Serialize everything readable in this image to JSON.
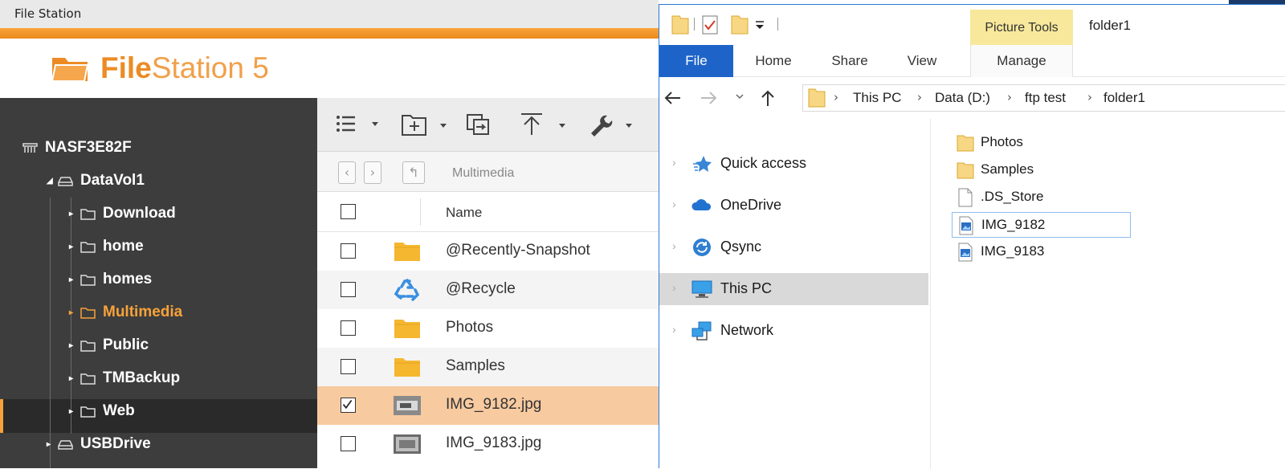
{
  "qnap": {
    "window_title": "File Station",
    "logo_bold": "File",
    "logo_rest": "Station 5",
    "tree": {
      "server": "NASF3E82F",
      "volume": "DataVol1",
      "folders": [
        "Download",
        "home",
        "homes",
        "Multimedia",
        "Public",
        "TMBackup",
        "Web"
      ],
      "selected": "Multimedia",
      "usb": "USBDrive"
    },
    "path_label": "Multimedia",
    "column_name": "Name",
    "files": [
      {
        "name": "@Recently-Snapshot",
        "icon": "folder-icon",
        "checked": false
      },
      {
        "name": "@Recycle",
        "icon": "recycle-icon",
        "checked": false
      },
      {
        "name": "Photos",
        "icon": "folder-icon",
        "checked": false
      },
      {
        "name": "Samples",
        "icon": "folder-icon",
        "checked": false
      },
      {
        "name": "IMG_9182.jpg",
        "icon": "image-thumbnail",
        "checked": true
      },
      {
        "name": "IMG_9183.jpg",
        "icon": "image-thumbnail",
        "checked": false
      }
    ],
    "accent": "#f7a23a"
  },
  "explorer": {
    "contextual_tab_group": "Picture Tools",
    "window_name": "folder1",
    "ribbon_tabs": [
      "File",
      "Home",
      "Share",
      "View",
      "Manage"
    ],
    "breadcrumb": [
      "This PC",
      "Data (D:)",
      "ftp test",
      "folder1"
    ],
    "nav_items": [
      {
        "label": "Quick access",
        "icon": "star-icon"
      },
      {
        "label": "OneDrive",
        "icon": "cloud-icon"
      },
      {
        "label": "Qsync",
        "icon": "sync-icon"
      },
      {
        "label": "This PC",
        "icon": "computer-icon",
        "selected": true
      },
      {
        "label": "Network",
        "icon": "network-icon"
      }
    ],
    "items": [
      {
        "label": "Photos",
        "icon": "folder-icon"
      },
      {
        "label": "Samples",
        "icon": "folder-icon"
      },
      {
        "label": ".DS_Store",
        "icon": "file-icon"
      },
      {
        "label": "IMG_9182",
        "icon": "image-file-icon",
        "focused": true
      },
      {
        "label": "IMG_9183",
        "icon": "image-file-icon"
      }
    ],
    "accent": "#1e64c8"
  }
}
